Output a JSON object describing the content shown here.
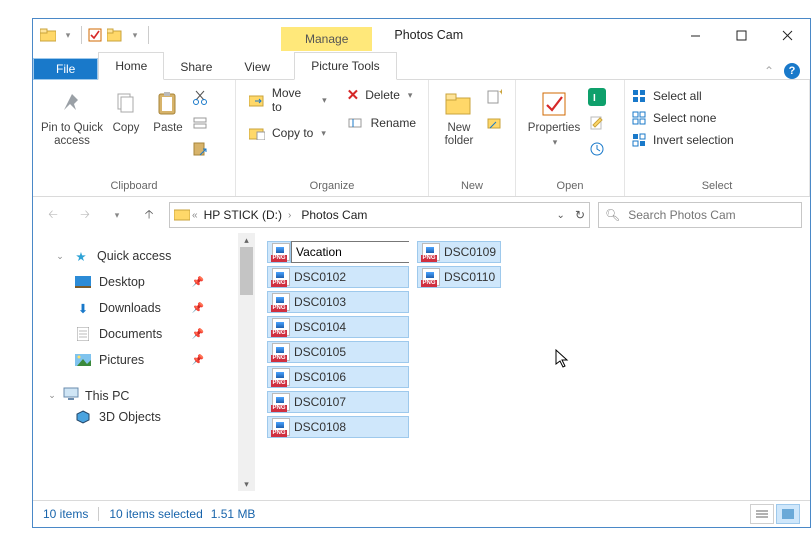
{
  "titlebar": {
    "context_label": "Manage",
    "context_tools": "Picture Tools",
    "app_title": "Photos Cam"
  },
  "tabs": {
    "file": "File",
    "home": "Home",
    "share": "Share",
    "view": "View"
  },
  "ribbon": {
    "clipboard": {
      "group_label": "Clipboard",
      "pin": "Pin to Quick access",
      "copy": "Copy",
      "paste": "Paste"
    },
    "organize": {
      "group_label": "Organize",
      "move_to": "Move to",
      "copy_to": "Copy to",
      "delete": "Delete",
      "rename": "Rename"
    },
    "new": {
      "group_label": "New",
      "new_folder": "New folder"
    },
    "open": {
      "group_label": "Open",
      "properties": "Properties"
    },
    "select": {
      "group_label": "Select",
      "all": "Select all",
      "none": "Select none",
      "invert": "Invert selection"
    }
  },
  "address": {
    "seg1": "HP STICK (D:)",
    "seg2": "Photos Cam"
  },
  "search": {
    "placeholder": "Search Photos Cam"
  },
  "nav": {
    "quick": "Quick access",
    "desktop": "Desktop",
    "downloads": "Downloads",
    "documents": "Documents",
    "pictures": "Pictures",
    "thispc": "This PC",
    "objects3d": "3D Objects"
  },
  "files": {
    "rename_value": "Vacation",
    "col1": [
      "DSC0102",
      "DSC0103",
      "DSC0104",
      "DSC0105",
      "DSC0106",
      "DSC0107",
      "DSC0108"
    ],
    "col2": [
      "DSC0109",
      "DSC0110"
    ]
  },
  "status": {
    "items": "10 items",
    "selected": "10 items selected",
    "size": "1.51 MB"
  }
}
